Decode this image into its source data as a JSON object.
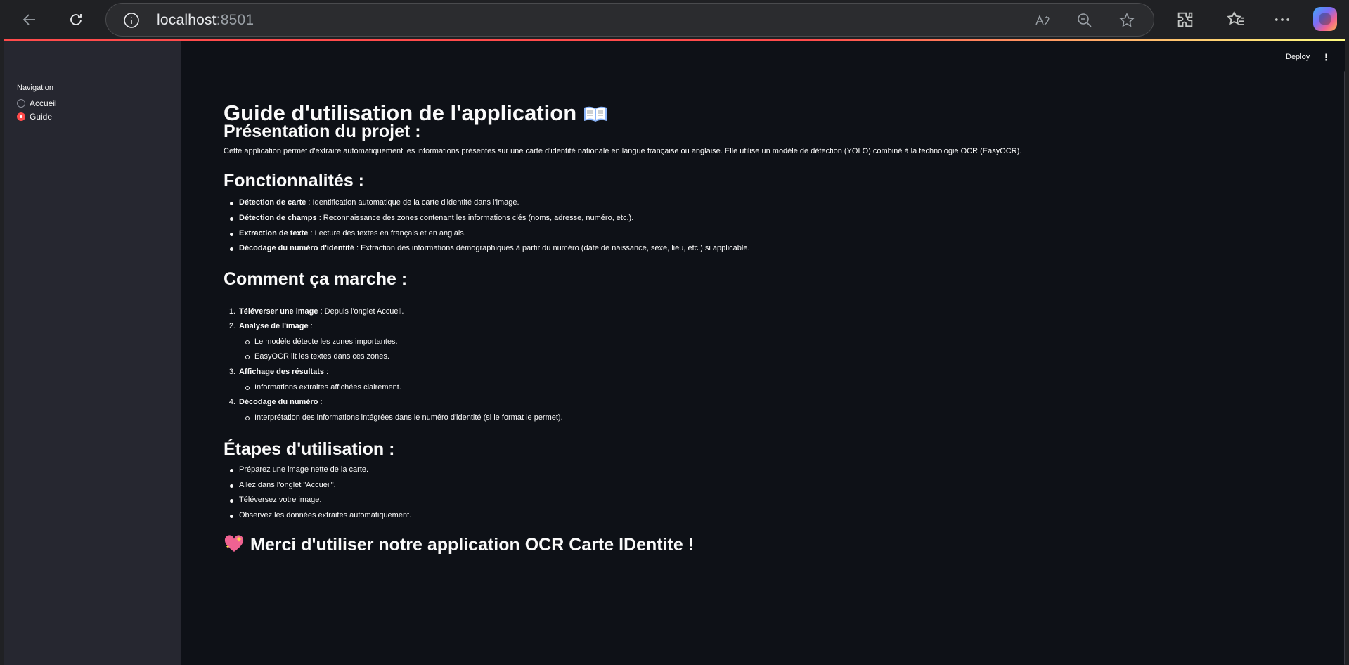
{
  "browser": {
    "url_host": "localhost",
    "url_port": ":8501"
  },
  "header": {
    "deploy_label": "Deploy",
    "menu_label": "⋮"
  },
  "sidebar": {
    "nav_title": "Navigation",
    "options": [
      {
        "label": "Accueil",
        "selected": false
      },
      {
        "label": "Guide",
        "selected": true
      }
    ]
  },
  "content": {
    "title": "Guide d'utilisation de l'application",
    "presentation": {
      "heading": "Présentation du projet :",
      "text": "Cette application permet d'extraire automatiquement les informations présentes sur une carte d'identité nationale en langue française ou anglaise. Elle utilise un modèle de détection (YOLO) combiné à la technologie OCR (EasyOCR)."
    },
    "features": {
      "heading": "Fonctionnalités :",
      "items": [
        {
          "bold": "Détection de carte",
          "text": " : Identification automatique de la carte d'identité dans l'image."
        },
        {
          "bold": "Détection de champs",
          "text": " : Reconnaissance des zones contenant les informations clés (noms, adresse, numéro, etc.)."
        },
        {
          "bold": "Extraction de texte",
          "text": " : Lecture des textes en français et en anglais."
        },
        {
          "bold": "Décodage du numéro d'identité",
          "text": " : Extraction des informations démographiques à partir du numéro (date de naissance, sexe, lieu, etc.) si applicable."
        }
      ]
    },
    "how": {
      "heading": "Comment ça marche :",
      "steps": [
        {
          "num": "1.",
          "bold": "Téléverser une image",
          "text": " : Depuis l'onglet Accueil."
        },
        {
          "num": "2.",
          "bold": "Analyse de l'image",
          "text": " :"
        },
        {
          "sub": "Le modèle détecte les zones importantes."
        },
        {
          "sub": "EasyOCR lit les textes dans ces zones."
        },
        {
          "num": "3.",
          "bold": "Affichage des résultats",
          "text": " :"
        },
        {
          "sub": "Informations extraites affichées clairement."
        },
        {
          "num": "4.",
          "bold": "Décodage du numéro",
          "text": " :"
        },
        {
          "sub": "Interprétation des informations intégrées dans le numéro d'identité (si le format le permet)."
        }
      ]
    },
    "usage": {
      "heading": "Étapes d'utilisation :",
      "items": [
        "Préparez une image nette de la carte.",
        "Allez dans l'onglet \"Accueil\".",
        "Téléversez votre image.",
        "Observez les données extraites automatiquement."
      ]
    },
    "thanks": "Merci d'utiliser notre application OCR Carte IDentite !"
  }
}
